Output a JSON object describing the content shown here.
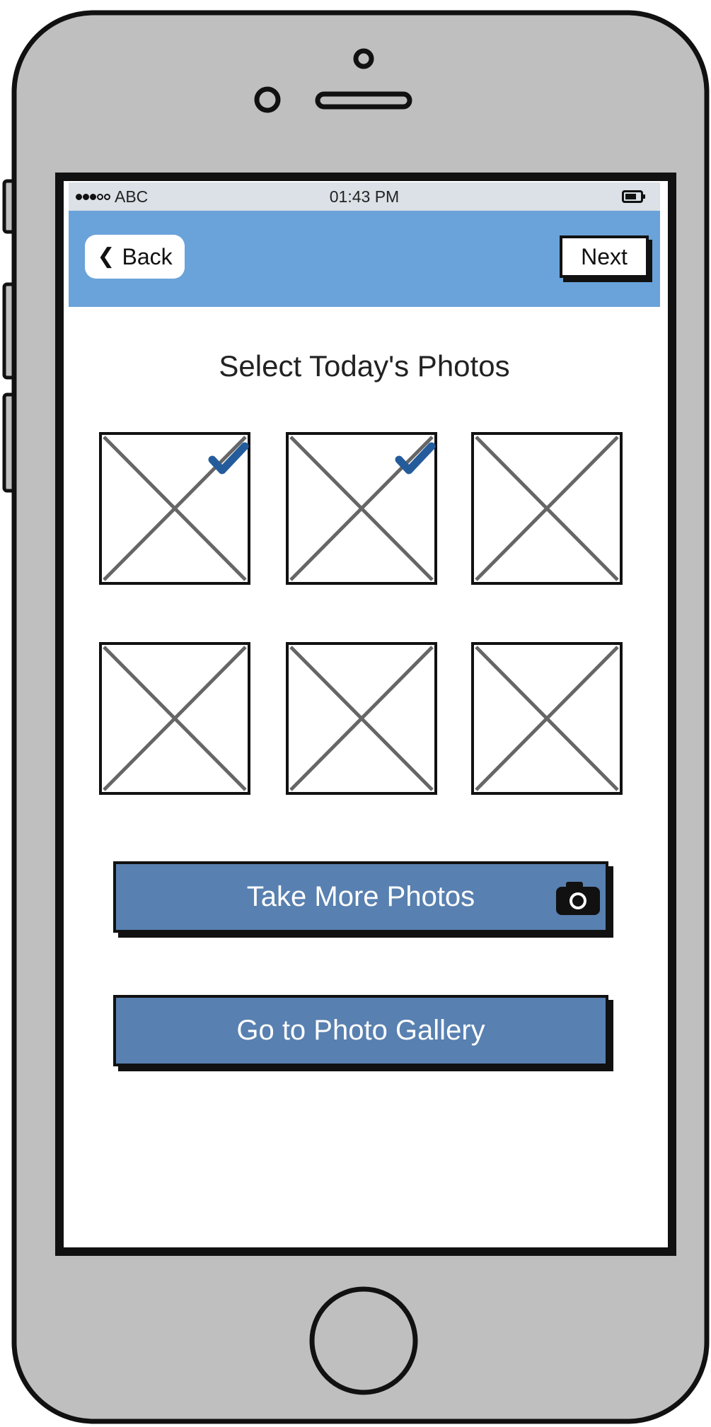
{
  "status_bar": {
    "carrier": "ABC",
    "time": "01:43 PM"
  },
  "nav_bar": {
    "back_label": "Back",
    "next_label": "Next"
  },
  "page_title": "Select Today's Photos",
  "photos": [
    {
      "selected": true
    },
    {
      "selected": true
    },
    {
      "selected": false
    },
    {
      "selected": false
    },
    {
      "selected": false
    },
    {
      "selected": false
    }
  ],
  "buttons": {
    "take_more_label": "Take More Photos",
    "gallery_label": "Go to Photo Gallery"
  },
  "colors": {
    "nav_bar": "#6aa3da",
    "status_bar": "#dbe1e6",
    "button_fill": "#5880b0",
    "check_mark": "#245c9b",
    "phone_body": "#bfbfbf"
  }
}
